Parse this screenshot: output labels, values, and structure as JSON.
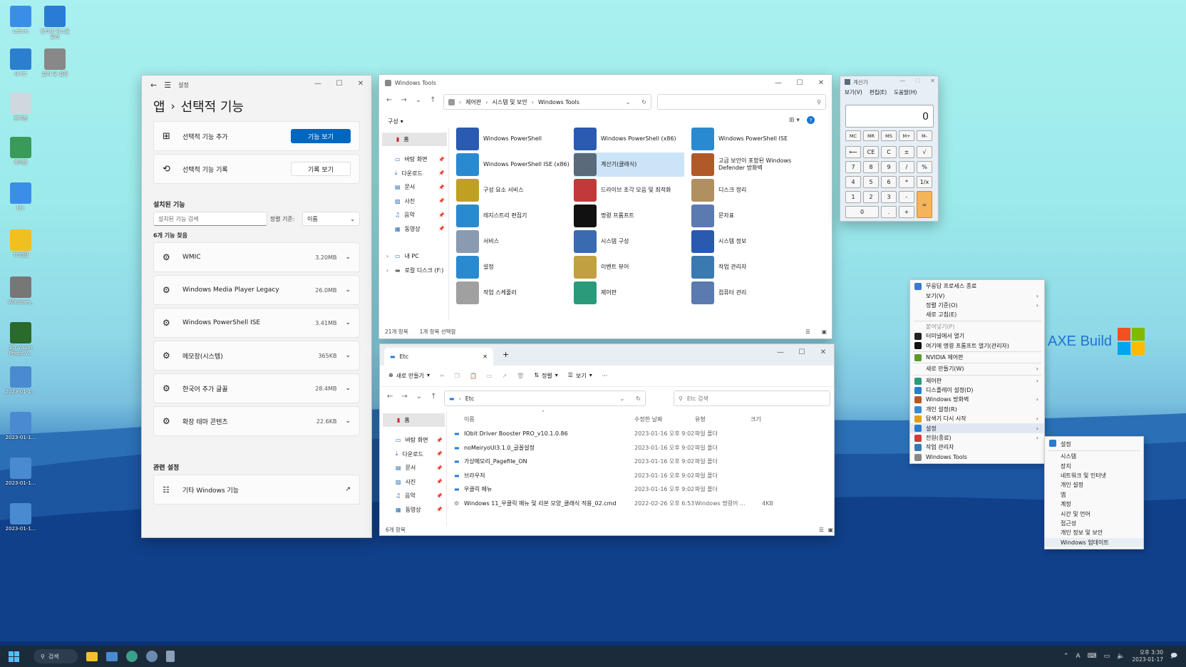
{
  "desktop": {
    "icons": [
      {
        "label": "Lebvis",
        "color": "#3b8ee8"
      },
      {
        "label": "인터넷 익스플로러",
        "color": "#2a7bd4"
      },
      {
        "label": "내 PC",
        "color": "#2c7fd0"
      },
      {
        "label": "설치 및 설정",
        "color": "#888888"
      },
      {
        "label": "휴지통",
        "color": "#cfd8df"
      },
      {
        "label": "제어판",
        "color": "#3a9a5a"
      },
      {
        "label": "Etc",
        "color": "#3b8ee8"
      },
      {
        "label": "TC레전",
        "color": "#f0c020"
      },
      {
        "label": "Windows_",
        "color": "#777777"
      },
      {
        "label": "3D Vision Photo V...",
        "color": "#2a6a2a"
      },
      {
        "label": "2023-01-1...",
        "color": "#4a8ad0"
      },
      {
        "label": "2023-01-1...",
        "color": "#4a8ad0"
      },
      {
        "label": "2023-01-1...",
        "color": "#4a8ad0"
      },
      {
        "label": "2023-01-1...",
        "color": "#4a8ad0"
      }
    ],
    "watermark": "AXE Build"
  },
  "settings": {
    "title": "설정",
    "breadcrumb_parent": "앱",
    "breadcrumb_sep": "›",
    "page_title": "선택적 기능",
    "add_label": "선택적 기능 추가",
    "add_button": "기능 보기",
    "history_label": "선택적 기능 기록",
    "history_button": "기록 보기",
    "installed_title": "설치된 기능",
    "search_placeholder": "설치된 기능 검색",
    "sort_label": "정렬 기준:",
    "sort_value": "이름",
    "count_text": "6개 기능 찾음",
    "features": [
      {
        "name": "WMIC",
        "size": "3.20MB"
      },
      {
        "name": "Windows Media Player Legacy",
        "size": "26.0MB"
      },
      {
        "name": "Windows PowerShell ISE",
        "size": "3.41MB"
      },
      {
        "name": "메모장(시스템)",
        "size": "365KB"
      },
      {
        "name": "한국어 추가 글꼴",
        "size": "28.4MB"
      },
      {
        "name": "확장 테마 콘텐츠",
        "size": "22.6KB"
      }
    ],
    "related_title": "관련 설정",
    "related_item": "기타 Windows 기능"
  },
  "tools": {
    "title": "Windows Tools",
    "path": [
      "제어판",
      "시스템 및 보안",
      "Windows Tools"
    ],
    "organize": "구성",
    "home": "홈",
    "nav": [
      "바탕 화면",
      "다운로드",
      "문서",
      "사진",
      "음악",
      "동영상"
    ],
    "nav_pc": "내 PC",
    "nav_disk": "로컬 디스크 (F:)",
    "items": [
      {
        "label": "Windows PowerShell",
        "color": "#2a5bb0"
      },
      {
        "label": "Windows PowerShell (x86)",
        "color": "#2a5bb0"
      },
      {
        "label": "Windows PowerShell ISE",
        "color": "#2a8ad0"
      },
      {
        "label": "Windows PowerShell ISE (x86)",
        "color": "#2a8ad0"
      },
      {
        "label": "계산기(클래식)",
        "color": "#5a6a7a"
      },
      {
        "label": "고급 보안이 포함된 Windows Defender 방화벽",
        "color": "#b05a2a"
      },
      {
        "label": "구성 요소 서비스",
        "color": "#c0a020"
      },
      {
        "label": "드라이브 조각 모음 및 최적화",
        "color": "#c03a3a"
      },
      {
        "label": "디스크 정리",
        "color": "#b09060"
      },
      {
        "label": "레지스트리 편집기",
        "color": "#2a8ad0"
      },
      {
        "label": "명령 프롬프트",
        "color": "#111111"
      },
      {
        "label": "문자표",
        "color": "#5a7ab0"
      },
      {
        "label": "서비스",
        "color": "#8a9ab0"
      },
      {
        "label": "시스템 구성",
        "color": "#3a6ab0"
      },
      {
        "label": "시스템 정보",
        "color": "#2a5ab0"
      },
      {
        "label": "설정",
        "color": "#2a8ad0"
      },
      {
        "label": "이벤트 뷰어",
        "color": "#c0a040"
      },
      {
        "label": "작업 관리자",
        "color": "#3a7ab0"
      },
      {
        "label": "작업 스케줄러",
        "color": "#a0a0a0"
      },
      {
        "label": "제어판",
        "color": "#2a9a7a"
      },
      {
        "label": "컴퓨터 관리",
        "color": "#5a7ab0"
      }
    ],
    "status_count": "21개 항목",
    "status_selected": "1개 항목 선택함"
  },
  "etc": {
    "tab": "Etc",
    "new": "새로 만들기",
    "sort": "정렬",
    "view": "보기",
    "path": "Etc",
    "search": "Etc 검색",
    "home": "홈",
    "nav": [
      "바탕 화면",
      "다운로드",
      "문서",
      "사진",
      "음악",
      "동영상"
    ],
    "cols": [
      "이름",
      "수정한 날짜",
      "유형",
      "크기"
    ],
    "files": [
      {
        "name": "IObit Driver Booster PRO_v10.1.0.86",
        "date": "2023-01-16 오후 9:02",
        "type": "파일 폴더",
        "size": "",
        "kind": "folder"
      },
      {
        "name": "noMeiryoUI3.1.0_글꼴설정",
        "date": "2023-01-16 오후 9:02",
        "type": "파일 폴더",
        "size": "",
        "kind": "folder"
      },
      {
        "name": "가상메모리_Pagefile_ON",
        "date": "2023-01-16 오후 9:02",
        "type": "파일 폴더",
        "size": "",
        "kind": "folder"
      },
      {
        "name": "브라우저",
        "date": "2023-01-16 오후 9:02",
        "type": "파일 폴더",
        "size": "",
        "kind": "folder"
      },
      {
        "name": "우클릭 메뉴",
        "date": "2023-01-16 오후 9:02",
        "type": "파일 폴더",
        "size": "",
        "kind": "folder"
      },
      {
        "name": "Windows 11_우클릭 메뉴 및 리본 모양_클래식 적용_02.cmd",
        "date": "2022-02-26 오후 6:53",
        "type": "Windows 명령어 ...",
        "size": "4KB",
        "kind": "file"
      }
    ],
    "status": "6개 항목"
  },
  "calc": {
    "title": "계산기",
    "menu": [
      "보기(V)",
      "편집(E)",
      "도움말(H)"
    ],
    "display": "0",
    "rows": [
      [
        "MC",
        "MR",
        "MS",
        "M+",
        "M-"
      ],
      [
        "⟵",
        "CE",
        "C",
        "±",
        "√"
      ],
      [
        "7",
        "8",
        "9",
        "/",
        "%"
      ],
      [
        "4",
        "5",
        "6",
        "*",
        "1/x"
      ],
      [
        "1",
        "2",
        "3",
        "-",
        ""
      ],
      [
        "0",
        "",
        ".",
        "+",
        ""
      ]
    ],
    "equals": "="
  },
  "ctx": {
    "items": [
      {
        "label": "무응답 프로세스 종료",
        "arrow": false,
        "color": "#3a7ad0"
      },
      {
        "label": "보기(V)",
        "arrow": true,
        "color": ""
      },
      {
        "label": "정렬 기준(O)",
        "arrow": true,
        "color": ""
      },
      {
        "label": "새로 고침(E)",
        "arrow": false,
        "color": ""
      },
      {
        "sep": true
      },
      {
        "label": "붙여넣기(P)",
        "arrow": false,
        "color": "",
        "dim": true
      },
      {
        "label": "터미널에서 열기",
        "arrow": false,
        "color": "#222222"
      },
      {
        "label": "여기에 명령 프롬프트 열기(관리자)",
        "arrow": false,
        "color": "#111111"
      },
      {
        "sep": true
      },
      {
        "label": "NVIDIA 제어판",
        "arrow": false,
        "color": "#5a9a2a"
      },
      {
        "sep": true
      },
      {
        "label": "새로 만들기(W)",
        "arrow": true,
        "color": ""
      },
      {
        "sep": true
      },
      {
        "label": "제어판",
        "arrow": true,
        "color": "#2a9a7a"
      },
      {
        "label": "디스플레이 설정(D)",
        "arrow": false,
        "color": "#2a7ad0"
      },
      {
        "label": "Windows 방화벽",
        "arrow": true,
        "color": "#b05a2a"
      },
      {
        "label": "개인 설정(R)",
        "arrow": false,
        "color": "#3a8ad0"
      },
      {
        "label": "탐색기 다시 시작",
        "arrow": true,
        "color": "#e0a020"
      },
      {
        "label": "설정",
        "arrow": true,
        "color": "#2a7ad0",
        "active": true
      },
      {
        "label": "전원(종료)",
        "arrow": true,
        "color": "#d03a3a"
      },
      {
        "label": "작업 관리자",
        "arrow": false,
        "color": "#3a7ab0"
      },
      {
        "label": "Windows Tools",
        "arrow": false,
        "color": "#888888"
      }
    ],
    "sub_title": "설정",
    "sub_items": [
      "시스템",
      "장치",
      "네트워크 및 인터넷",
      "개인 설정",
      "앱",
      "계정",
      "시간 및 언어",
      "접근성",
      "개인 정보 및 보안",
      "Windows 업데이트"
    ]
  },
  "taskbar": {
    "search": "검색",
    "time": "오후 3:30",
    "date": "2023-01-17",
    "lang": "A"
  }
}
